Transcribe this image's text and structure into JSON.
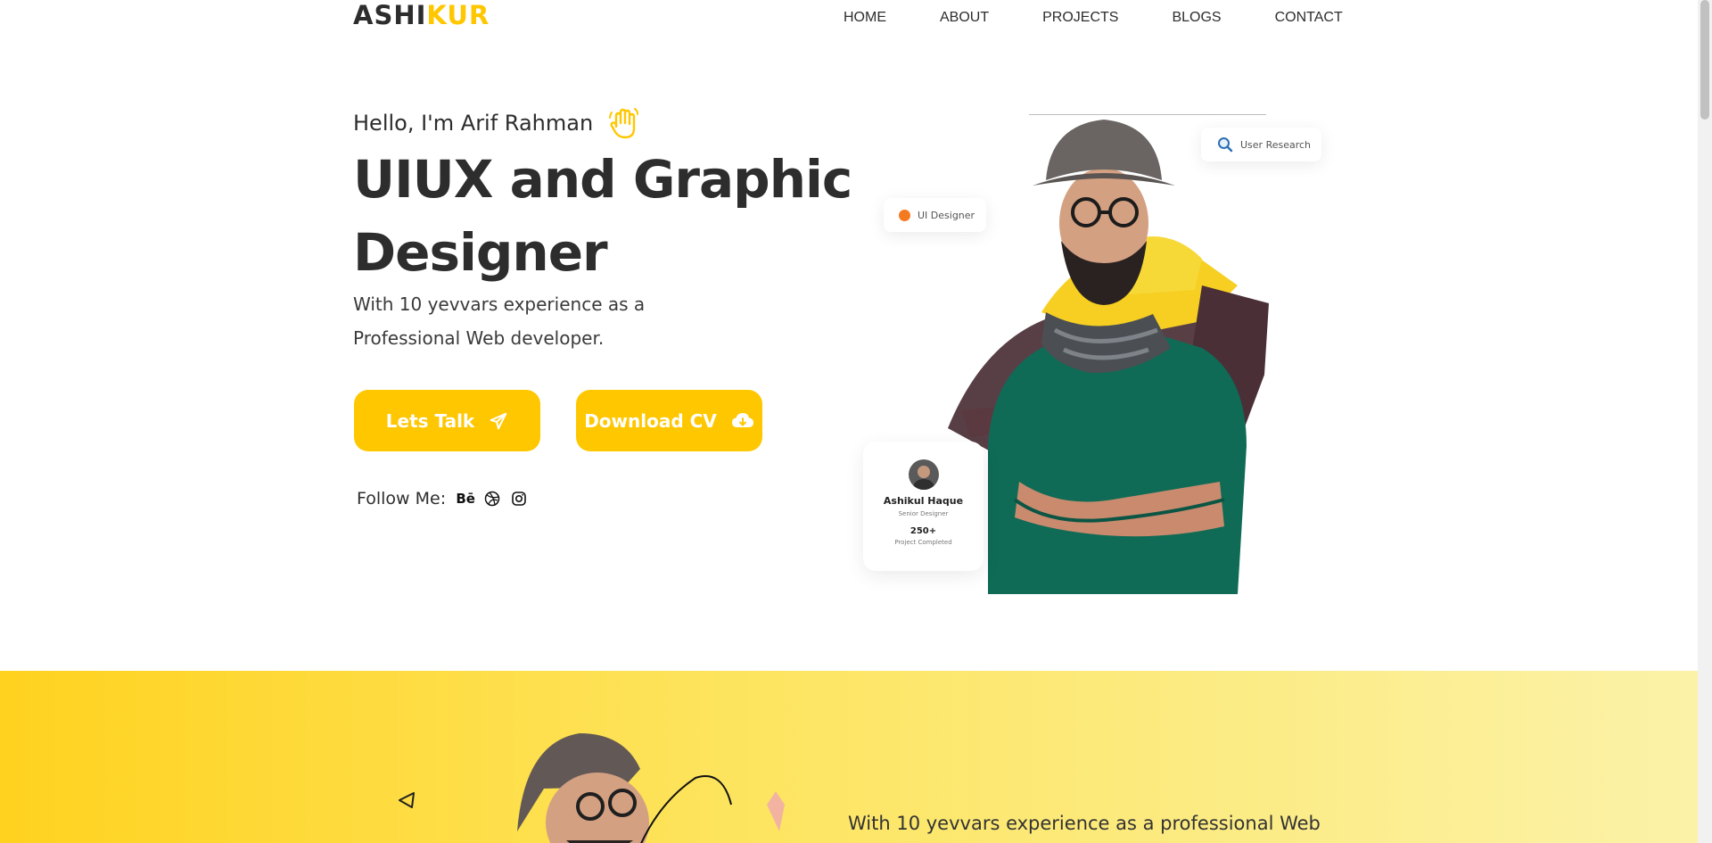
{
  "nav": {
    "logo_part1": "ASHI",
    "logo_part2": "KUR",
    "items": [
      "HOME",
      "ABOUT",
      "PROJECTS",
      "BLOGS",
      "CONTACT"
    ]
  },
  "hero": {
    "greeting": "Hello, I'm Arif Rahman",
    "greeting_icon": "waving-hand-icon",
    "headline_line1": "UIUX and Graphic",
    "headline_line2": "Designer",
    "subtitle_line1": "With 10 yevvars experience as a",
    "subtitle_line2": "Professional Web developer.",
    "btn_talk": "Lets Talk",
    "btn_talk_icon": "send-icon",
    "btn_cv": "Download CV",
    "btn_cv_icon": "cloud-download-icon",
    "follow_label": "Follow Me:",
    "social": [
      {
        "icon": "behance-icon",
        "text": "Bē"
      },
      {
        "icon": "dribbble-icon"
      },
      {
        "icon": "instagram-icon"
      }
    ]
  },
  "hero_art": {
    "chip_research": "User Research",
    "chip_designer": "UI Designer",
    "profile_name": "Ashikul Haque",
    "profile_role": "Senior Designer",
    "profile_count": "250+",
    "profile_count_label": "Project Completed"
  },
  "about": {
    "text": "With 10 yevvars experience as a professional Web"
  },
  "colors": {
    "accent": "#ffc700",
    "text": "#2d2d2d",
    "sweater": "#0f6b55",
    "orange_dot": "#f47a20"
  }
}
